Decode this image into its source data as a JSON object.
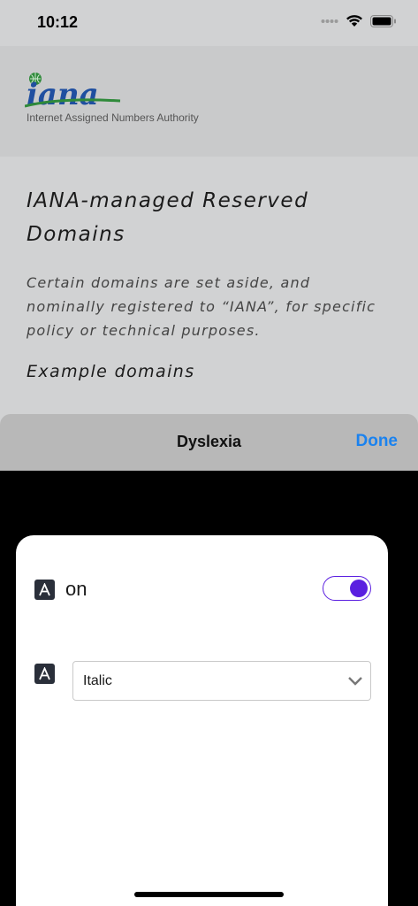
{
  "status": {
    "time": "10:12"
  },
  "site": {
    "logo_text": "iana",
    "tagline": "Internet Assigned Numbers Authority",
    "heading": "IANA-managed Reserved Domains",
    "intro": "Certain domains are set aside, and nominally registered to “IANA”, for specific policy or technical purposes.",
    "subheading": "Example domains"
  },
  "sheet": {
    "title": "Dyslexia",
    "done_label": "Done"
  },
  "panel": {
    "toggle_label": "on",
    "toggle_on": true,
    "font_style_value": "Italic"
  },
  "colors": {
    "accent": "#5a1fe0",
    "link": "#1a82ef"
  },
  "icons": [
    "wifi-icon",
    "battery-icon",
    "cellular-icon",
    "letter-a-icon",
    "chevron-down-icon"
  ]
}
